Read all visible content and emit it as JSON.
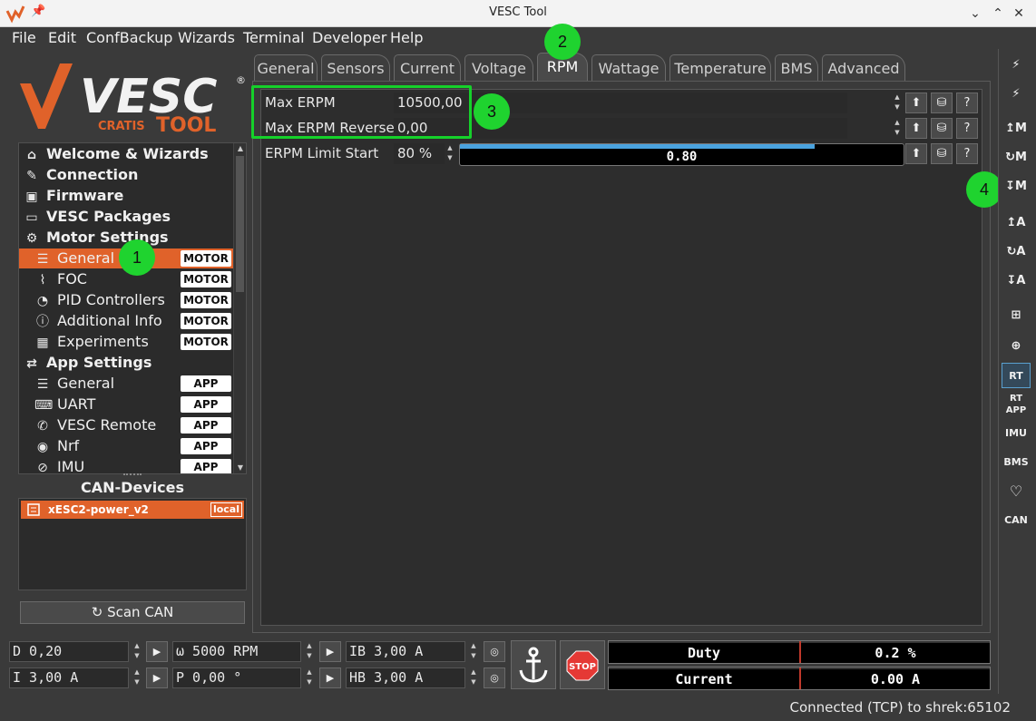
{
  "window": {
    "title": "VESC Tool"
  },
  "menu": [
    "File",
    "Edit",
    "ConfBackup",
    "Wizards",
    "Terminal",
    "Developer",
    "Help"
  ],
  "brand": {
    "logo_text": "VESC",
    "sub_left": "CRATIS",
    "sub_right": "TOOL"
  },
  "nav": {
    "items": [
      {
        "label": "Welcome & Wizards",
        "icon": "home-icon"
      },
      {
        "label": "Connection",
        "icon": "plug-icon"
      },
      {
        "label": "Firmware",
        "icon": "chip-icon"
      },
      {
        "label": "VESC Packages",
        "icon": "package-icon"
      },
      {
        "label": "Motor Settings",
        "icon": "motor-icon"
      },
      {
        "label": "General",
        "icon": "sliders-icon",
        "badge": "MOTOR"
      },
      {
        "label": "FOC",
        "icon": "foc-icon",
        "badge": "MOTOR"
      },
      {
        "label": "PID Controllers",
        "icon": "gauge-icon",
        "badge": "MOTOR"
      },
      {
        "label": "Additional Info",
        "icon": "info-icon",
        "badge": "MOTOR"
      },
      {
        "label": "Experiments",
        "icon": "calculator-icon",
        "badge": "MOTOR"
      },
      {
        "label": "App Settings",
        "icon": "app-icon"
      },
      {
        "label": "General",
        "icon": "sliders-icon",
        "badge": "APP"
      },
      {
        "label": "UART",
        "icon": "uart-icon",
        "badge": "APP"
      },
      {
        "label": "VESC Remote",
        "icon": "remote-icon",
        "badge": "APP"
      },
      {
        "label": "Nrf",
        "icon": "wireless-icon",
        "badge": "APP"
      },
      {
        "label": "IMU",
        "icon": "imu-icon",
        "badge": "APP"
      }
    ]
  },
  "can": {
    "title": "CAN-Devices",
    "device": {
      "name": "xESC2-power_v2",
      "tag": "local"
    },
    "scan_label": "Scan CAN"
  },
  "tabs": [
    "General",
    "Sensors",
    "Current",
    "Voltage",
    "RPM",
    "Wattage",
    "Temperature",
    "BMS",
    "Advanced"
  ],
  "active_tab": "RPM",
  "params": [
    {
      "label": "Max ERPM",
      "value": "10500,00"
    },
    {
      "label": "Max ERPM Reverse",
      "value": "0,00"
    },
    {
      "label": "ERPM Limit Start",
      "value": "80 %",
      "slider_text": "0.80",
      "slider_fraction": 0.8
    }
  ],
  "callouts": [
    "1",
    "2",
    "3",
    "4"
  ],
  "right_toolbar": [
    {
      "label": "",
      "icon": "connect-icon"
    },
    {
      "label": "",
      "icon": "disconnect-icon"
    },
    {
      "label": "↥M",
      "icon": "read-motor-icon"
    },
    {
      "label": "↻M",
      "icon": "reset-motor-icon"
    },
    {
      "label": "↧M",
      "icon": "write-motor-icon"
    },
    {
      "label": "↥A",
      "icon": "read-app-icon"
    },
    {
      "label": "↻A",
      "icon": "reset-app-icon"
    },
    {
      "label": "↧A",
      "icon": "write-app-icon"
    },
    {
      "label": "",
      "icon": "network-icon"
    },
    {
      "label": "",
      "icon": "gamepad-icon"
    },
    {
      "label": "RT",
      "icon": "realtime-icon"
    },
    {
      "label": "RT APP",
      "icon": "realtime-app-icon"
    },
    {
      "label": "IMU",
      "icon": "imu-data-icon"
    },
    {
      "label": "BMS",
      "icon": "bms-icon"
    },
    {
      "label": "",
      "icon": "heart-icon"
    },
    {
      "label": "CAN",
      "icon": "can-icon"
    }
  ],
  "controls": {
    "duty": "D 0,20",
    "speed": "ω 5000 RPM",
    "brake_current": "IB 3,00 A",
    "current": "I 3,00 A",
    "position": "P 0,00 °",
    "handbrake": "HB 3,00 A"
  },
  "gauges": [
    {
      "label": "Duty",
      "value": "0.2 %"
    },
    {
      "label": "Current",
      "value": "0.00 A"
    }
  ],
  "stop_label": "STOP",
  "status": "Connected (TCP) to shrek:65102"
}
